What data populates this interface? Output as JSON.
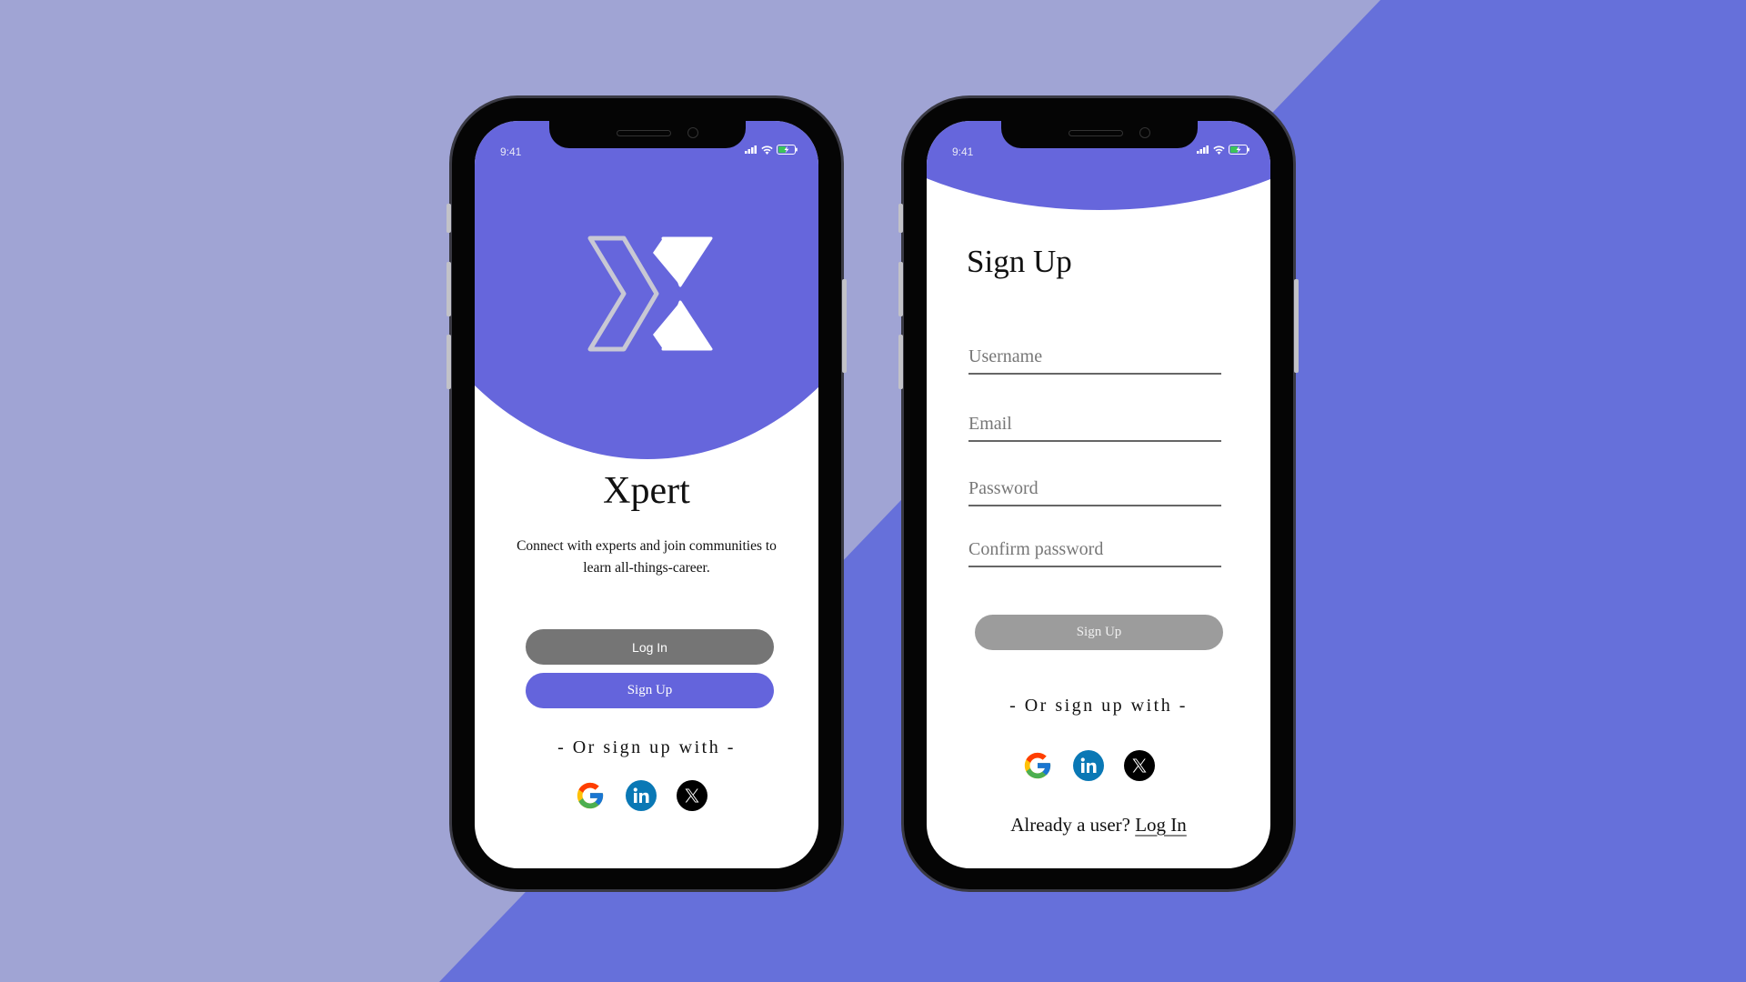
{
  "colors": {
    "background_light": "#a0a4d4",
    "background_dark": "#6670da",
    "brand_purple": "#6666dc",
    "login_button_gray": "#757575",
    "signup_disabled_gray": "#9c9c9c"
  },
  "status_bar": {
    "time": "9:41",
    "icons": [
      "signal-icon",
      "wifi-icon",
      "battery-charging-icon"
    ]
  },
  "welcome_screen": {
    "logo": "xpert-logo",
    "app_name": "Xpert",
    "tagline_line1": "Connect with experts and join communities to",
    "tagline_line2": "learn all-things-career.",
    "login_button": "Log In",
    "signup_button": "Sign Up",
    "social_prompt": "- Or sign up with -",
    "social_providers": [
      "Google",
      "LinkedIn",
      "X"
    ]
  },
  "signup_screen": {
    "title": "Sign Up",
    "fields": [
      {
        "name": "username",
        "placeholder": "Username",
        "value": ""
      },
      {
        "name": "email",
        "placeholder": "Email",
        "value": ""
      },
      {
        "name": "password",
        "placeholder": "Password",
        "value": ""
      },
      {
        "name": "confirm_password",
        "placeholder": "Confirm password",
        "value": ""
      }
    ],
    "submit_button": "Sign Up",
    "social_prompt": "- Or sign up with -",
    "social_providers": [
      "Google",
      "LinkedIn",
      "X"
    ],
    "already_user_text": "Already a user?",
    "login_link": "Log In"
  }
}
